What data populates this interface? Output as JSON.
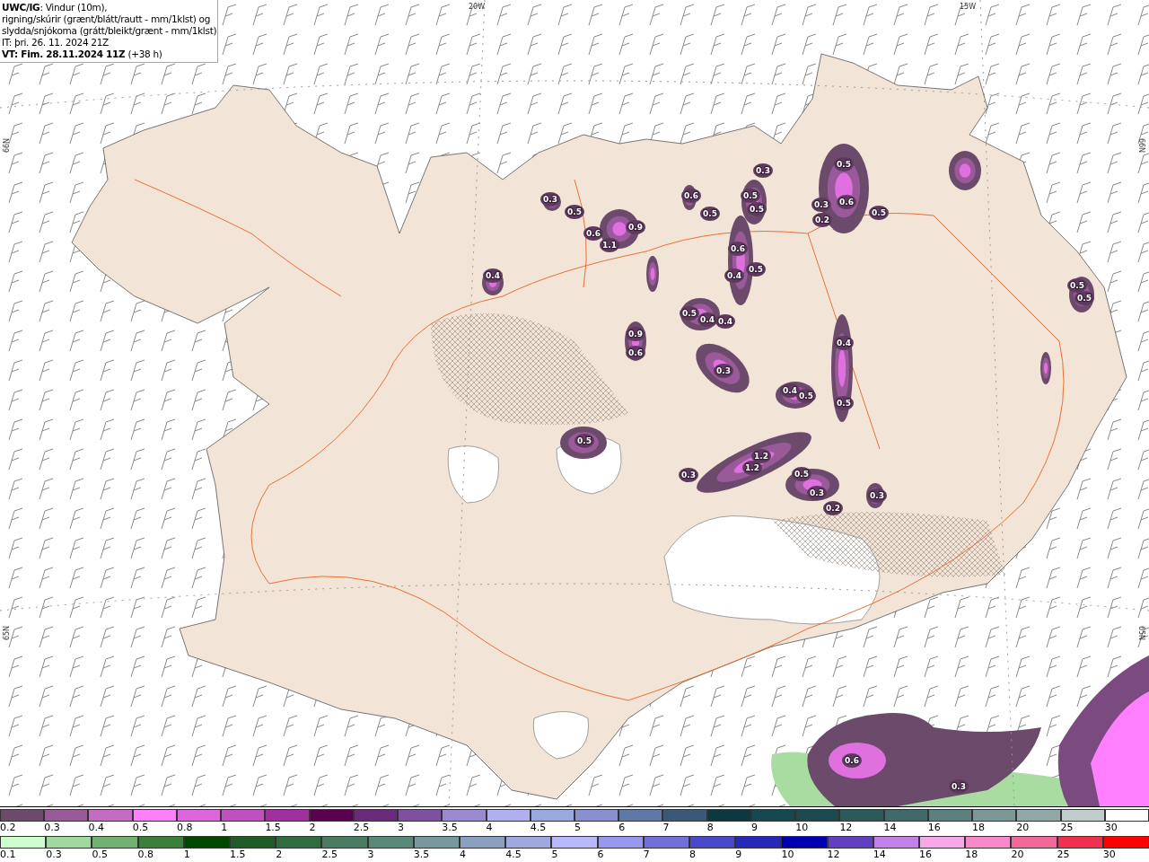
{
  "header": {
    "lines": [
      "**UWC/IG**: Vindur (10m),",
      "rigning/skúrir (grænt/blátt/rautt - mm/1klst) og",
      "slydda/snjókoma (grátt/bleikt/grænt - mm/1klst)",
      "IT: þri. 26. 11. 2024 21Z",
      "**VT: Fim. 28.11.2024 11Z** (+38 h)"
    ]
  },
  "map": {
    "grid_labels": [
      "20W",
      "15W",
      "66N",
      "66N",
      "65N",
      "65N"
    ],
    "values": [
      "0.5",
      "0.3",
      "0.6",
      "0.5",
      "0.3",
      "0.6",
      "0.3",
      "0.5",
      "0.5",
      "0.5",
      "0.5",
      "0.2",
      "0.9",
      "0.6",
      "1.1",
      "0.6",
      "0.5",
      "0.4",
      "0.4",
      "0.5",
      "0.5",
      "0.5",
      "0.4",
      "0.4",
      "0.9",
      "0.4",
      "0.6",
      "0.3",
      "0.4",
      "0.5",
      "0.5",
      "0.5",
      "1.2",
      "1.2",
      "0.5",
      "0.3",
      "0.3",
      "0.3",
      "0.2",
      "0.6",
      "0.3"
    ]
  },
  "legends": [
    {
      "entries": [
        {
          "label": "0.2",
          "color": "#6b4a6b"
        },
        {
          "label": "0.3",
          "color": "#9a5a9a"
        },
        {
          "label": "0.4",
          "color": "#c46cc4"
        },
        {
          "label": "0.5",
          "color": "#ff80ff"
        },
        {
          "label": "0.8",
          "color": "#dd66dd"
        },
        {
          "label": "1",
          "color": "#c050c0"
        },
        {
          "label": "1.5",
          "color": "#a030a0"
        },
        {
          "label": "2",
          "color": "#5a0050"
        },
        {
          "label": "2.5",
          "color": "#6a2a7a"
        },
        {
          "label": "3",
          "color": "#8050a0"
        },
        {
          "label": "3.5",
          "color": "#9a88d0"
        },
        {
          "label": "4",
          "color": "#b0b0f0"
        },
        {
          "label": "4.5",
          "color": "#98a8e0"
        },
        {
          "label": "5",
          "color": "#8890d0"
        },
        {
          "label": "6",
          "color": "#6078a8"
        },
        {
          "label": "7",
          "color": "#3a5878"
        },
        {
          "label": "8",
          "color": "#0a3a40"
        },
        {
          "label": "9",
          "color": "#154850"
        },
        {
          "label": "10",
          "color": "#1a4a50"
        },
        {
          "label": "12",
          "color": "#2a5a5a"
        },
        {
          "label": "14",
          "color": "#406a6a"
        },
        {
          "label": "16",
          "color": "#5a8080"
        },
        {
          "label": "18",
          "color": "#7a9898"
        },
        {
          "label": "20",
          "color": "#90a8a8"
        },
        {
          "label": "25",
          "color": "#c0cccc"
        },
        {
          "label": "30",
          "color": "#ffffff"
        }
      ]
    },
    {
      "entries": [
        {
          "label": "0.1",
          "color": "#ccffcc"
        },
        {
          "label": "0.3",
          "color": "#a0d8a0"
        },
        {
          "label": "0.5",
          "color": "#70b070"
        },
        {
          "label": "0.8",
          "color": "#3a803a"
        },
        {
          "label": "1",
          "color": "#004800"
        },
        {
          "label": "1.5",
          "color": "#205c28"
        },
        {
          "label": "2",
          "color": "#306c40"
        },
        {
          "label": "2.5",
          "color": "#4a7a60"
        },
        {
          "label": "3",
          "color": "#5a8878"
        },
        {
          "label": "3.5",
          "color": "#7898a0"
        },
        {
          "label": "4",
          "color": "#8aa0c0"
        },
        {
          "label": "4.5",
          "color": "#a0a8e0"
        },
        {
          "label": "5",
          "color": "#b8b8ff"
        },
        {
          "label": "6",
          "color": "#9898f0"
        },
        {
          "label": "7",
          "color": "#7070d8"
        },
        {
          "label": "8",
          "color": "#4848c8"
        },
        {
          "label": "9",
          "color": "#2828b8"
        },
        {
          "label": "10",
          "color": "#0000b0"
        },
        {
          "label": "12",
          "color": "#6040c0"
        },
        {
          "label": "14",
          "color": "#c080e8"
        },
        {
          "label": "16",
          "color": "#f8a8e8"
        },
        {
          "label": "18",
          "color": "#f888c8"
        },
        {
          "label": "20",
          "color": "#f06898"
        },
        {
          "label": "25",
          "color": "#f03050"
        },
        {
          "label": "30",
          "color": "#ff0000"
        }
      ]
    }
  ]
}
